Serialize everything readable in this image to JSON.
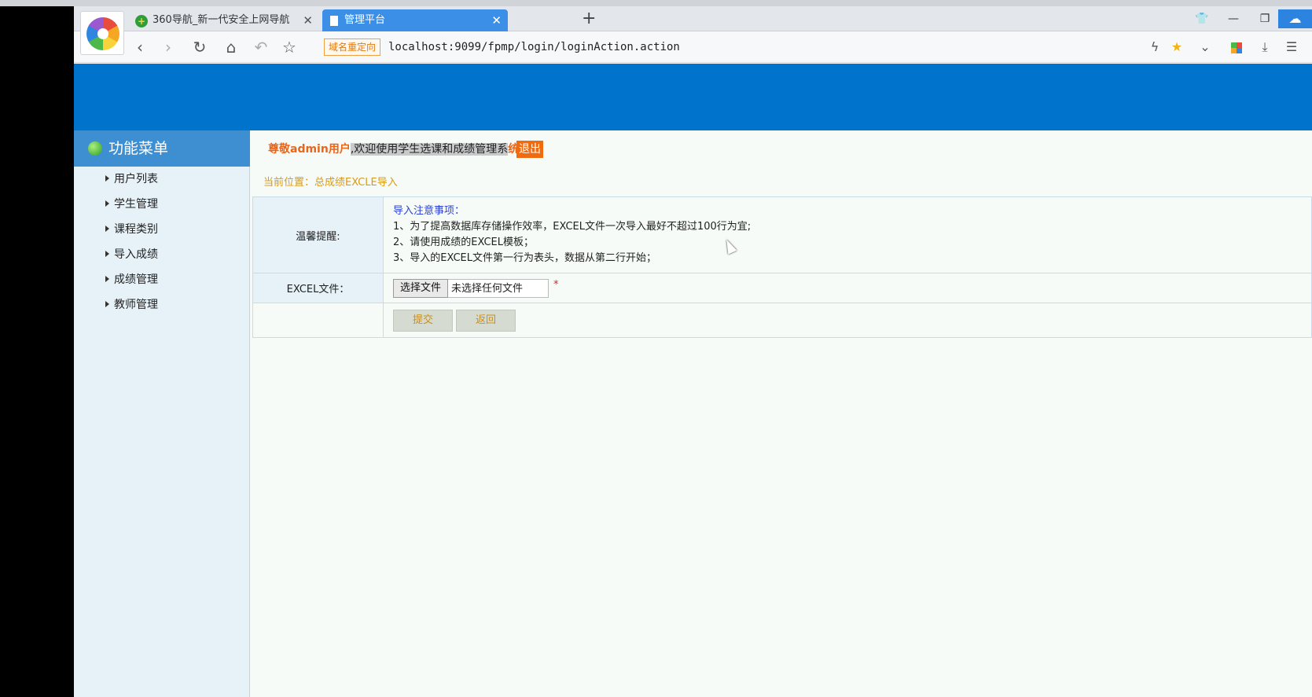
{
  "browser": {
    "tabs": [
      {
        "title": "360导航_新一代安全上网导航",
        "active": false
      },
      {
        "title": "管理平台",
        "active": true
      }
    ],
    "new_tab": "+",
    "redirect_badge": "域名重定向",
    "url": "localhost:9099/fpmp/login/loginAction.action",
    "accent_color": "#3b8fe6"
  },
  "page": {
    "banner_color": "#0074cc",
    "sidebar": {
      "title": "功能菜单",
      "items": [
        "用户列表",
        "学生管理",
        "课程类别",
        "导入成绩",
        "成绩管理",
        "教师管理"
      ]
    },
    "welcome": {
      "part1": "尊敬admin用户",
      "part2": ",欢迎使用学生选课和成绩管理系",
      "part3": "统"
    },
    "logout": "退出",
    "breadcrumb": "当前位置：总成绩EXCLE导入",
    "form": {
      "notice_label": "温馨提醒:",
      "notice_title": "导入注意事项：",
      "notice_lines": [
        "1、为了提高数据库存储操作效率，EXCEL文件一次导入最好不超过100行为宜;",
        "2、请使用成绩的EXCEL模板；",
        "3、导入的EXCEL文件第一行为表头，数据从第二行开始；"
      ],
      "file_label": "EXCEL文件：",
      "choose_button": "选择文件",
      "file_status": "未选择任何文件",
      "required_mark": "*",
      "submit": "提交",
      "back": "返回"
    }
  }
}
